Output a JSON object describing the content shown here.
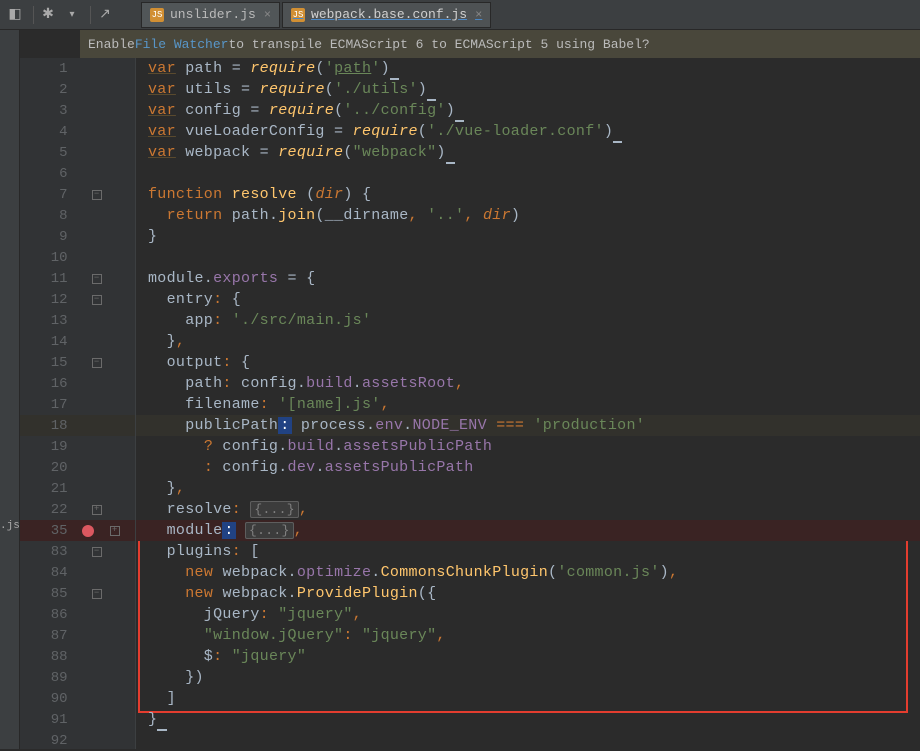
{
  "toolbar": {
    "icon1": "◧",
    "icon2": "✱",
    "icon3": "↗"
  },
  "tabs": [
    {
      "icon": "JS",
      "label": "unslider.js",
      "active": false
    },
    {
      "icon": "JS",
      "label": "webpack.base.conf.js",
      "active": true
    }
  ],
  "banner": {
    "prefix": "Enable ",
    "link": "File Watcher",
    "suffix": " to transpile ECMAScript 6 to ECMAScript 5 using Babel?"
  },
  "left_rail": {
    "item": ".js"
  },
  "code_lines": [
    {
      "n": 1,
      "t": [
        [
          "kw-u",
          "var"
        ],
        [
          "id",
          " path "
        ],
        [
          "id",
          "= "
        ],
        [
          "fn-i",
          "require"
        ],
        [
          "id",
          "("
        ],
        [
          "str",
          "'"
        ],
        [
          "str-u",
          "path"
        ],
        [
          "str",
          "'"
        ],
        [
          "id",
          ")"
        ],
        [
          "caret-u",
          " "
        ]
      ]
    },
    {
      "n": 2,
      "t": [
        [
          "kw-u",
          "var"
        ],
        [
          "id",
          " utils "
        ],
        [
          "id",
          "= "
        ],
        [
          "fn-i",
          "require"
        ],
        [
          "id",
          "("
        ],
        [
          "str",
          "'./utils'"
        ],
        [
          "id",
          ")"
        ],
        [
          "caret-u",
          " "
        ]
      ]
    },
    {
      "n": 3,
      "t": [
        [
          "kw-u",
          "var"
        ],
        [
          "id",
          " config "
        ],
        [
          "id",
          "= "
        ],
        [
          "fn-i",
          "require"
        ],
        [
          "id",
          "("
        ],
        [
          "str",
          "'../config'"
        ],
        [
          "id",
          ")"
        ],
        [
          "caret-u",
          " "
        ]
      ]
    },
    {
      "n": 4,
      "t": [
        [
          "kw-u",
          "var"
        ],
        [
          "id",
          " vueLoaderConfig "
        ],
        [
          "id",
          "= "
        ],
        [
          "fn-i",
          "require"
        ],
        [
          "id",
          "("
        ],
        [
          "str",
          "'./vue-loader.conf'"
        ],
        [
          "id",
          ")"
        ],
        [
          "caret-u",
          " "
        ]
      ]
    },
    {
      "n": 5,
      "t": [
        [
          "kw-u",
          "var"
        ],
        [
          "id",
          " webpack "
        ],
        [
          "id",
          "= "
        ],
        [
          "fn-i",
          "require"
        ],
        [
          "id",
          "("
        ],
        [
          "str",
          "\"webpack\""
        ],
        [
          "id",
          ")"
        ],
        [
          "caret-u",
          " "
        ]
      ]
    },
    {
      "n": 6,
      "t": []
    },
    {
      "n": 7,
      "fold": "-",
      "t": [
        [
          "kw",
          "function "
        ],
        [
          "fn",
          "resolve "
        ],
        [
          "id",
          "("
        ],
        [
          "param-i",
          "dir"
        ],
        [
          "id",
          ") {"
        ]
      ]
    },
    {
      "n": 8,
      "t": [
        [
          "id",
          "  "
        ],
        [
          "kw",
          "return "
        ],
        [
          "id",
          "path."
        ],
        [
          "fn",
          "join"
        ],
        [
          "id",
          "("
        ],
        [
          "id",
          "__dirname"
        ],
        [
          "punct",
          ","
        ],
        [
          "id",
          " "
        ],
        [
          "str",
          "'..'"
        ],
        [
          "punct",
          ","
        ],
        [
          "id",
          " "
        ],
        [
          "param-i",
          "dir"
        ],
        [
          "id",
          ")"
        ]
      ]
    },
    {
      "n": 9,
      "foldEnd": true,
      "t": [
        [
          "id",
          "}"
        ]
      ]
    },
    {
      "n": 10,
      "t": []
    },
    {
      "n": 11,
      "fold": "-",
      "t": [
        [
          "id",
          "module."
        ],
        [
          "prop",
          "exports"
        ],
        [
          "id",
          " = {"
        ]
      ]
    },
    {
      "n": 12,
      "fold": "-",
      "t": [
        [
          "id",
          "  entry"
        ],
        [
          "punct",
          ":"
        ],
        [
          "id",
          " {"
        ]
      ]
    },
    {
      "n": 13,
      "t": [
        [
          "id",
          "    app"
        ],
        [
          "punct",
          ":"
        ],
        [
          "id",
          " "
        ],
        [
          "str",
          "'./src/main.js'"
        ]
      ]
    },
    {
      "n": 14,
      "foldEnd": true,
      "t": [
        [
          "id",
          "  }"
        ],
        [
          "punct",
          ","
        ]
      ]
    },
    {
      "n": 15,
      "fold": "-",
      "t": [
        [
          "id",
          "  output"
        ],
        [
          "punct",
          ":"
        ],
        [
          "id",
          " {"
        ]
      ]
    },
    {
      "n": 16,
      "t": [
        [
          "id",
          "    path"
        ],
        [
          "punct",
          ":"
        ],
        [
          "id",
          " config."
        ],
        [
          "prop",
          "build"
        ],
        [
          "id",
          "."
        ],
        [
          "prop",
          "assetsRoot"
        ],
        [
          "punct",
          ","
        ]
      ]
    },
    {
      "n": 17,
      "t": [
        [
          "id",
          "    filename"
        ],
        [
          "punct",
          ":"
        ],
        [
          "id",
          " "
        ],
        [
          "str",
          "'[name].js'"
        ],
        [
          "punct",
          ","
        ]
      ]
    },
    {
      "n": 18,
      "curr": true,
      "t": [
        [
          "id",
          "    publicPath"
        ],
        [
          "cursor-band",
          ":"
        ],
        [
          "id",
          " process."
        ],
        [
          "prop",
          "env"
        ],
        [
          "id",
          "."
        ],
        [
          "prop",
          "NODE_ENV"
        ],
        [
          "id",
          " "
        ],
        [
          "punct",
          "==="
        ],
        [
          "id",
          " "
        ],
        [
          "str",
          "'production'"
        ]
      ]
    },
    {
      "n": 19,
      "t": [
        [
          "id",
          "      "
        ],
        [
          "punct",
          "?"
        ],
        [
          "id",
          " config."
        ],
        [
          "prop",
          "build"
        ],
        [
          "id",
          "."
        ],
        [
          "prop",
          "assetsPublicPath"
        ]
      ]
    },
    {
      "n": 20,
      "t": [
        [
          "id",
          "      "
        ],
        [
          "punct",
          ":"
        ],
        [
          "id",
          " config."
        ],
        [
          "prop",
          "dev"
        ],
        [
          "id",
          "."
        ],
        [
          "prop",
          "assetsPublicPath"
        ]
      ]
    },
    {
      "n": 21,
      "foldEnd": true,
      "t": [
        [
          "id",
          "  }"
        ],
        [
          "punct",
          ","
        ]
      ]
    },
    {
      "n": 22,
      "fold": "+",
      "t": [
        [
          "id",
          "  resolve"
        ],
        [
          "punct",
          ":"
        ],
        [
          "id",
          " "
        ],
        [
          "folded",
          "{...}"
        ],
        [
          "punct",
          ","
        ]
      ]
    },
    {
      "n": 35,
      "fold": "+",
      "bp": true,
      "t": [
        [
          "id",
          "  module"
        ],
        [
          "cursor-band",
          ":"
        ],
        [
          "id",
          " "
        ],
        [
          "folded",
          "{...}"
        ],
        [
          "punct",
          ","
        ]
      ]
    },
    {
      "n": 83,
      "fold": "-",
      "t": [
        [
          "id",
          "  plugins"
        ],
        [
          "punct",
          ":"
        ],
        [
          "id",
          " ["
        ]
      ]
    },
    {
      "n": 84,
      "t": [
        [
          "id",
          "    "
        ],
        [
          "kw",
          "new "
        ],
        [
          "id",
          "webpack."
        ],
        [
          "prop",
          "optimize"
        ],
        [
          "id",
          "."
        ],
        [
          "fn",
          "CommonsChunkPlugin"
        ],
        [
          "id",
          "("
        ],
        [
          "str",
          "'common.js'"
        ],
        [
          "id",
          ")"
        ],
        [
          "punct",
          ","
        ]
      ]
    },
    {
      "n": 85,
      "fold": "-",
      "t": [
        [
          "id",
          "    "
        ],
        [
          "kw",
          "new "
        ],
        [
          "id",
          "webpack."
        ],
        [
          "fn",
          "ProvidePlugin"
        ],
        [
          "id",
          "({"
        ]
      ]
    },
    {
      "n": 86,
      "t": [
        [
          "id",
          "      jQuery"
        ],
        [
          "punct",
          ":"
        ],
        [
          "id",
          " "
        ],
        [
          "str",
          "\"jquery\""
        ],
        [
          "punct",
          ","
        ]
      ]
    },
    {
      "n": 87,
      "t": [
        [
          "id",
          "      "
        ],
        [
          "str",
          "\"window.jQuery\""
        ],
        [
          "punct",
          ":"
        ],
        [
          "id",
          " "
        ],
        [
          "str",
          "\"jquery\""
        ],
        [
          "punct",
          ","
        ]
      ]
    },
    {
      "n": 88,
      "t": [
        [
          "id",
          "      $"
        ],
        [
          "punct",
          ":"
        ],
        [
          "id",
          " "
        ],
        [
          "str",
          "\"jquery\""
        ]
      ]
    },
    {
      "n": 89,
      "foldEnd": true,
      "t": [
        [
          "id",
          "    })"
        ]
      ]
    },
    {
      "n": 90,
      "foldEnd": true,
      "t": [
        [
          "id",
          "  ]"
        ]
      ]
    },
    {
      "n": 91,
      "foldEnd": true,
      "t": [
        [
          "id",
          "}"
        ],
        [
          "caret-u",
          " "
        ]
      ]
    },
    {
      "n": 92,
      "t": []
    }
  ],
  "redbox": {
    "top_line_index": 23,
    "height_lines": 8
  }
}
